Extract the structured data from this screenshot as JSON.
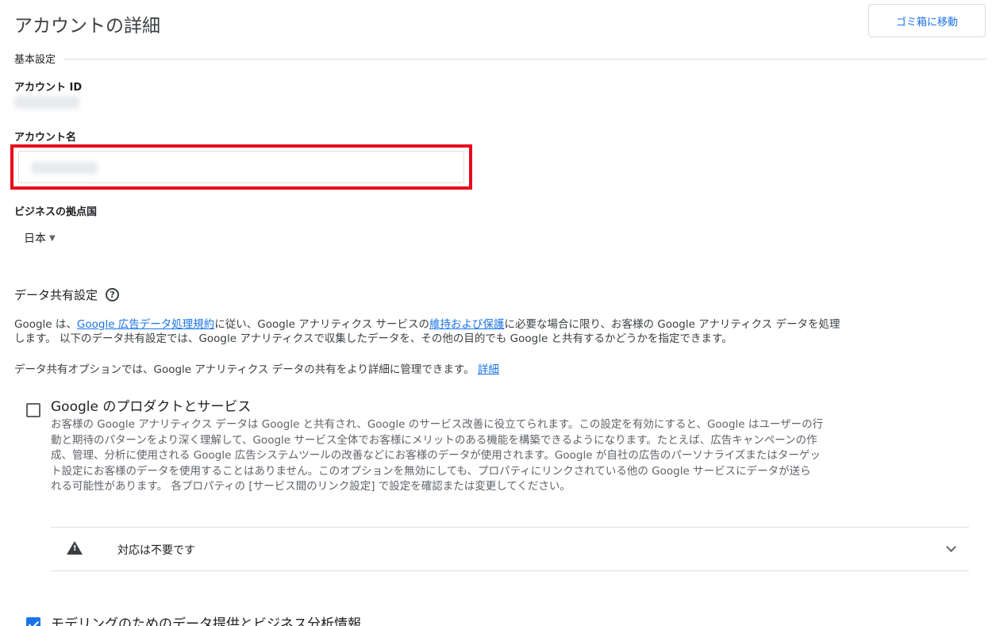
{
  "header": {
    "title": "アカウントの詳細",
    "trash_button": "ゴミ箱に移動"
  },
  "basic": {
    "section_label": "基本設定",
    "account_id_label": "アカウント ID",
    "account_name_label": "アカウント名",
    "country_label": "ビジネスの拠点国",
    "country_value": "日本"
  },
  "sharing": {
    "title": "データ共有設定",
    "para1": {
      "pre": "Google は、",
      "link1": "Google 広告データ処理規約",
      "mid": "に従い、Google アナリティクス サービスの",
      "link2": "維持および保護",
      "post": "に必要な場合に限り、お客様の Google アナリティクス データを処理",
      "line2": "します。 以下のデータ共有設定では、Google アナリティクスで収集したデータを、その他の目的でも Google と共有するかどうかを指定できます。"
    },
    "para2": {
      "text": "データ共有オプションでは、Google アナリティクス データの共有をより詳細に管理できます。 ",
      "link": "詳細"
    },
    "option1": {
      "title": "Google のプロダクトとサービス",
      "checked": false,
      "desc_lines": [
        "お客様の Google アナリティクス データは Google と共有され、Google のサービス改善に役立てられます。この設定を有効にすると、Google はユーザーの行",
        "動と期待のパターンをより深く理解して、Google サービス全体でお客様にメリットのある機能を構築できるようになります。たとえば、広告キャンペーンの作",
        "成、管理、分析に使用される Google 広告システムツールの改善などにお客様のデータが使用されます。Google が自社の広告のパーソナライズまたはターゲッ",
        "ト設定にお客様のデータを使用することはありません。このオプションを無効にしても、プロパティにリンクされている他の Google サービスにデータが送ら",
        "れる可能性があります。 各プロパティの [サービス間のリンク設定] で設定を確認または変更してください。"
      ],
      "notice": "対応は不要です"
    },
    "option2": {
      "title": "モデリングのためのデータ提供とビジネス分析情報",
      "checked": true
    }
  }
}
